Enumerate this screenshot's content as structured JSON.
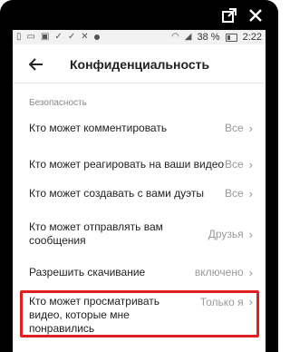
{
  "status_bar": {
    "battery_percent": "38 %",
    "time": "2:22"
  },
  "header": {
    "title": "Конфиденциальность"
  },
  "section": {
    "label": "Безопасность"
  },
  "rows": [
    {
      "label": "Кто может комментировать",
      "value": "Все"
    },
    {
      "label": "Кто может реагировать на ваши видео",
      "value": "Все"
    },
    {
      "label": "Кто может создавать с вами дуэты",
      "value": "Все"
    },
    {
      "label": "Кто может отправлять вам сообщения",
      "value": "Друзья"
    },
    {
      "label": "Разрешить скачивание",
      "value": "включено"
    },
    {
      "label": "Кто может просматривать видео, которые мне понравились",
      "value": "Только я"
    }
  ],
  "colors": {
    "highlight": "#e02020",
    "text": "#222222",
    "muted": "#999999"
  }
}
